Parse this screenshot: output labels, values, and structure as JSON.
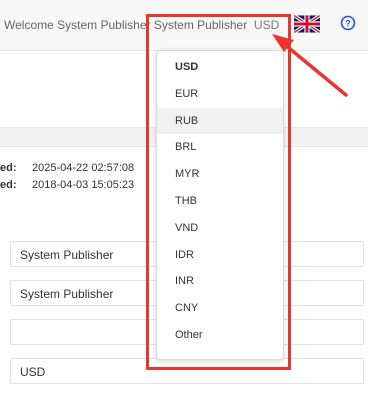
{
  "header": {
    "welcome": "Welcome System Publisher System Publisher",
    "currency": "USD"
  },
  "meta": {
    "row1_label": "ed:",
    "row1_value": "2025-04-22 02:57:08",
    "row2_label": "ed:",
    "row2_value": "2018-04-03 15:05:23"
  },
  "form": {
    "field1": "System Publisher",
    "field2": "System Publisher",
    "field3": "",
    "field4": "USD"
  },
  "currency_dropdown": {
    "selected": "USD",
    "hovered": "RUB",
    "options": [
      "USD",
      "EUR",
      "RUB",
      "BRL",
      "MYR",
      "THB",
      "VND",
      "IDR",
      "INR",
      "CNY",
      "Other"
    ]
  },
  "colors": {
    "annotation_red": "#e8362c",
    "help_blue": "#2c4fd6"
  },
  "icons": {
    "flag": "uk-flag-icon",
    "help": "question-circle-icon"
  }
}
